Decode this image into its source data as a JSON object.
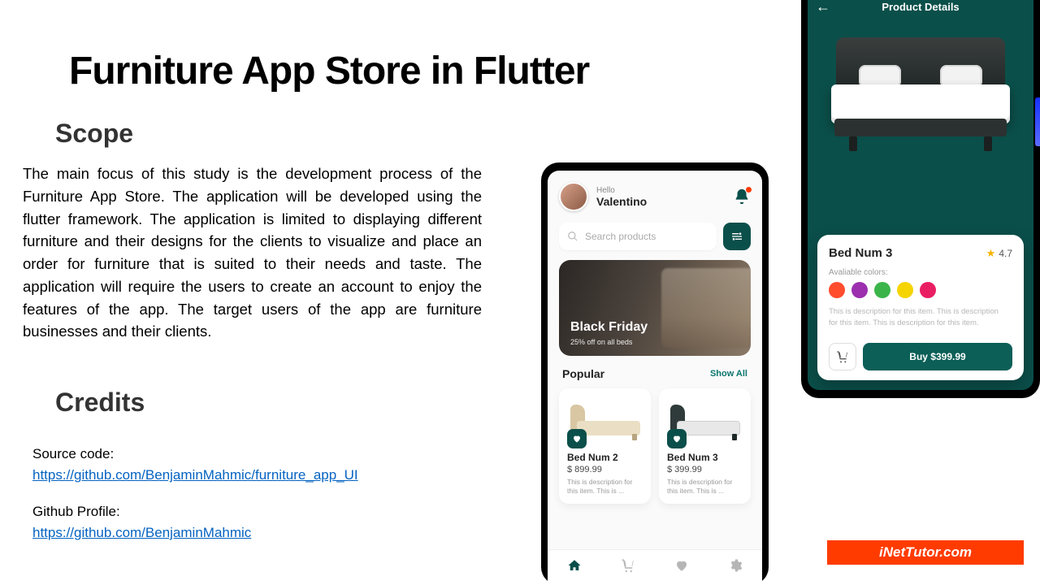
{
  "title": "Furniture App Store in Flutter",
  "scope": {
    "heading": "Scope",
    "body": "The main focus of this study is the development process of the Furniture App Store. The application will be developed using the flutter framework. The application is limited to displaying different furniture and their designs for the clients to visualize and place an order for furniture that is suited to their needs and taste. The application will require the users to create an account to enjoy the features of the app. The target users of the app are furniture businesses and their clients."
  },
  "credits": {
    "heading": "Credits",
    "source_label": "Source code:",
    "source_url": "https://github.com/BenjaminMahmic/furniture_app_UI",
    "profile_label": "Github Profile:",
    "profile_url": "https://github.com/BenjaminMahmic"
  },
  "badge": "iNetTutor.com",
  "phone_home": {
    "greeting_small": "Hello",
    "greeting_name": "Valentino",
    "search_placeholder": "Search products",
    "banner_title": "Black Friday",
    "banner_sub": "25% off on all beds",
    "popular_label": "Popular",
    "show_all": "Show All",
    "cards": [
      {
        "name": "Bed Num 2",
        "price": "$ 899.99",
        "desc": "This is description for this item. This is ..."
      },
      {
        "name": "Bed Num 3",
        "price": "$ 399.99",
        "desc": "This is description for this item. This is ..."
      }
    ]
  },
  "phone_details": {
    "header": "Product Details",
    "product_name": "Bed Num 3",
    "rating": "4.7",
    "available_label": "Avaliable colors:",
    "colors": [
      "#ff4d2e",
      "#9b2fae",
      "#3bb54a",
      "#f5d400",
      "#e91e63"
    ],
    "desc": "This is description for this item. This is description for this item. This is description for this item.",
    "buy_label": "Buy  $399.99"
  }
}
